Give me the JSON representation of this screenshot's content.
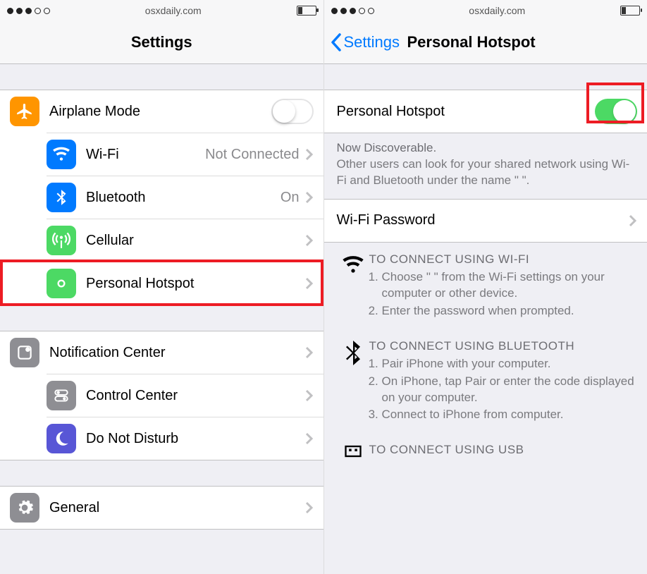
{
  "statusbar": {
    "site": "osxdaily.com"
  },
  "left": {
    "title": "Settings",
    "items": [
      {
        "label": "Airplane Mode",
        "detail": "",
        "toggle": "off"
      },
      {
        "label": "Wi-Fi",
        "detail": "Not Connected"
      },
      {
        "label": "Bluetooth",
        "detail": "On"
      },
      {
        "label": "Cellular",
        "detail": ""
      },
      {
        "label": "Personal Hotspot",
        "detail": ""
      }
    ],
    "items2": [
      {
        "label": "Notification Center"
      },
      {
        "label": "Control Center"
      },
      {
        "label": "Do Not Disturb"
      }
    ],
    "items3": [
      {
        "label": "General"
      }
    ]
  },
  "right": {
    "back": "Settings",
    "title": "Personal Hotspot",
    "main": {
      "label": "Personal Hotspot",
      "toggle": "on"
    },
    "discover_title": "Now Discoverable.",
    "discover_body": "Other users can look for your shared network using Wi-Fi and Bluetooth under the name \"                       \".",
    "wifi_pw": "Wi-Fi Password",
    "inst_wifi_head": "TO CONNECT USING WI-FI",
    "inst_wifi_1": "Choose \"                        \" from the Wi-Fi settings on your computer or other device.",
    "inst_wifi_2": "Enter the password when prompted.",
    "inst_bt_head": "TO CONNECT USING BLUETOOTH",
    "inst_bt_1": "Pair iPhone with your computer.",
    "inst_bt_2": "On iPhone, tap Pair or enter the code displayed on your computer.",
    "inst_bt_3": "Connect to iPhone from computer.",
    "inst_usb_head": "TO CONNECT USING USB"
  }
}
